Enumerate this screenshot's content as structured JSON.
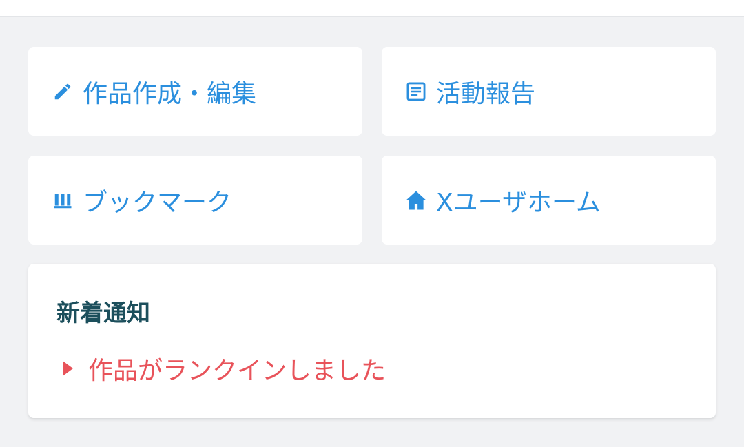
{
  "colors": {
    "accent": "#2b8fde",
    "notice_title": "#1c4f5c",
    "notice_link": "#e8535a",
    "background": "#f1f2f4"
  },
  "menu": {
    "tiles": [
      {
        "icon": "pencil-icon",
        "label": "作品作成・編集"
      },
      {
        "icon": "document-icon",
        "label": "活動報告"
      },
      {
        "icon": "bookmark-shelf-icon",
        "label": "ブックマーク"
      },
      {
        "icon": "home-icon",
        "label": "Xユーザホーム"
      }
    ]
  },
  "notifications": {
    "title": "新着通知",
    "items": [
      {
        "icon": "triangle-right-icon",
        "text": "作品がランクインしました"
      }
    ]
  }
}
